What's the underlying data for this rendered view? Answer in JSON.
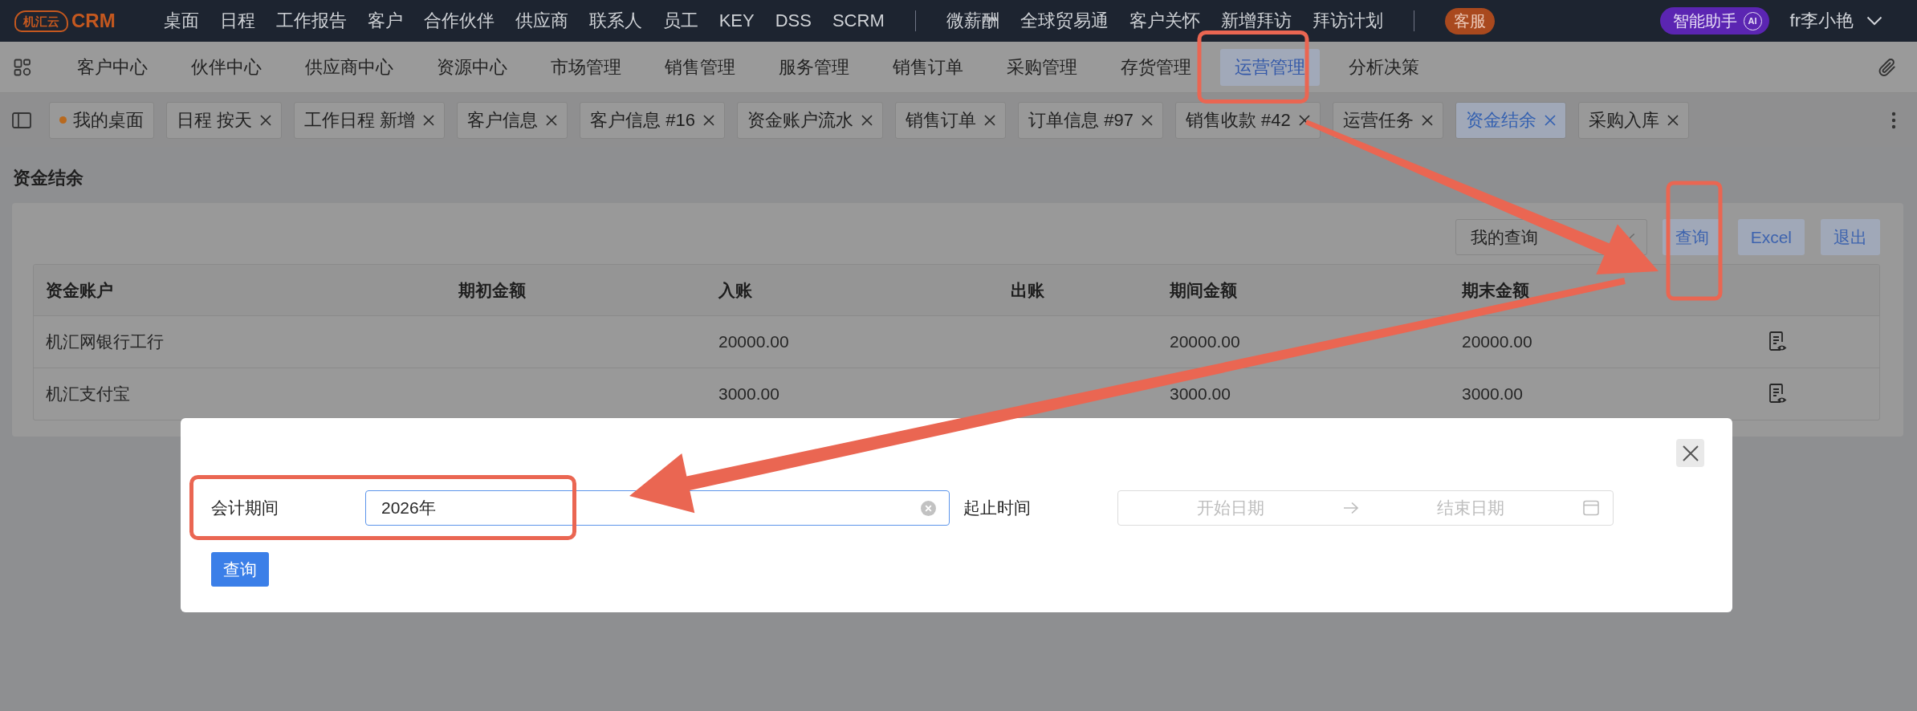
{
  "top_bar": {
    "logo_badge": "机汇云",
    "logo_text": "CRM",
    "menu_groups": [
      [
        "桌面",
        "日程",
        "工作报告",
        "客户",
        "合作伙伴",
        "供应商",
        "联系人",
        "员工",
        "KEY",
        "DSS",
        "SCRM"
      ],
      [
        "微薪酬",
        "全球贸易通",
        "客户关怀",
        "新增拜访",
        "拜访计划"
      ]
    ],
    "service_button": "客服",
    "assistant_button": {
      "label": "智能助手",
      "badge": "AI"
    },
    "user": "fr李小艳"
  },
  "module_nav": [
    {
      "label": "客户中心",
      "selected": false
    },
    {
      "label": "伙伴中心",
      "selected": false
    },
    {
      "label": "供应商中心",
      "selected": false
    },
    {
      "label": "资源中心",
      "selected": false
    },
    {
      "label": "市场管理",
      "selected": false
    },
    {
      "label": "销售管理",
      "selected": false
    },
    {
      "label": "服务管理",
      "selected": false
    },
    {
      "label": "销售订单",
      "selected": false
    },
    {
      "label": "采购管理",
      "selected": false
    },
    {
      "label": "存货管理",
      "selected": false
    },
    {
      "label": "运营管理",
      "selected": true
    },
    {
      "label": "分析决策",
      "selected": false
    }
  ],
  "tabs": [
    {
      "kind": "home",
      "label": "我的桌面",
      "selected": false
    },
    {
      "kind": "page",
      "label": "日程 按天",
      "selected": false
    },
    {
      "kind": "page",
      "label": "工作日程 新增",
      "selected": false
    },
    {
      "kind": "page",
      "label": "客户信息",
      "selected": false
    },
    {
      "kind": "page",
      "label": "客户信息 #16",
      "selected": false
    },
    {
      "kind": "page",
      "label": "资金账户流水",
      "selected": false
    },
    {
      "kind": "page",
      "label": "销售订单",
      "selected": false
    },
    {
      "kind": "page",
      "label": "订单信息 #97",
      "selected": false
    },
    {
      "kind": "page",
      "label": "销售收款 #42",
      "selected": false
    },
    {
      "kind": "page",
      "label": "运营任务",
      "selected": false
    },
    {
      "kind": "page",
      "label": "资金结余",
      "selected": true
    },
    {
      "kind": "page",
      "label": "采购入库",
      "selected": false
    }
  ],
  "page_title": "资金结余",
  "toolbar": {
    "query_select": {
      "value": "我的查询"
    },
    "buttons": [
      "查询",
      "Excel",
      "退出"
    ]
  },
  "table": {
    "columns": [
      "资金账户",
      "期初金额",
      "入账",
      "出账",
      "期间金额",
      "期末金额"
    ],
    "rows": [
      {
        "cells": [
          "机汇网银行工行",
          null,
          "20000.00",
          null,
          "20000.00",
          "20000.00"
        ]
      },
      {
        "cells": [
          "机汇支付宝",
          null,
          "3000.00",
          null,
          "3000.00",
          "3000.00"
        ]
      }
    ]
  },
  "dialog": {
    "fields": [
      {
        "kind": "text",
        "label": "会计期间",
        "value": "2026年"
      },
      {
        "kind": "date_range",
        "label": "起止时间",
        "start_placeholder": "开始日期",
        "end_placeholder": "结束日期"
      }
    ],
    "submit": "查询"
  }
}
